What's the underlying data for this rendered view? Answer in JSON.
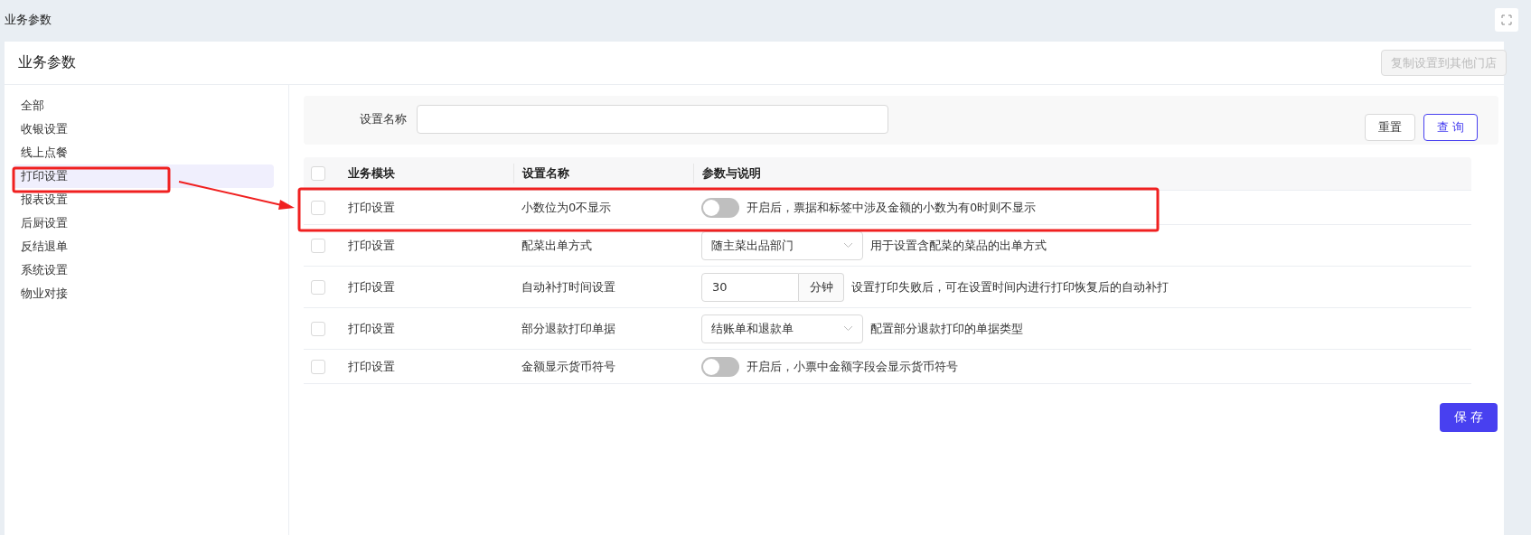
{
  "window": {
    "title": "业务参数"
  },
  "card": {
    "title": "业务参数",
    "copy_button": {
      "label": "复制设置到其他门店",
      "disabled": true
    }
  },
  "sidebar": {
    "items": [
      {
        "label": "全部",
        "selected": false
      },
      {
        "label": "收银设置",
        "selected": false
      },
      {
        "label": "线上点餐",
        "selected": false
      },
      {
        "label": "打印设置",
        "selected": true
      },
      {
        "label": "报表设置",
        "selected": false
      },
      {
        "label": "后厨设置",
        "selected": false
      },
      {
        "label": "反结退单",
        "selected": false
      },
      {
        "label": "系统设置",
        "selected": false
      },
      {
        "label": "物业对接",
        "selected": false
      }
    ]
  },
  "filter": {
    "label": "设置名称",
    "buttons": [
      {
        "label": "重置",
        "kind": "default"
      },
      {
        "label": "查 询",
        "kind": "primary"
      }
    ]
  },
  "table": {
    "header_checked": false,
    "columns": [
      "业务模块",
      "设置名称",
      "参数与说明"
    ],
    "rows": [
      {
        "checked": false,
        "module": "打印设置",
        "name": "小数位为0不显示",
        "control": {
          "kind": "switch",
          "on": false
        },
        "description": "开启后，票据和标签中涉及金额的小数为有0时则不显示"
      },
      {
        "checked": false,
        "module": "打印设置",
        "name": "配菜出单方式",
        "control": {
          "kind": "select",
          "value": "随主菜出品部门"
        },
        "description": "用于设置含配菜的菜品的出单方式"
      },
      {
        "checked": false,
        "module": "打印设置",
        "name": "自动补打时间设置",
        "control": {
          "kind": "number",
          "value": "30",
          "unit": "分钟"
        },
        "description": "设置打印失败后，可在设置时间内进行打印恢复后的自动补打"
      },
      {
        "checked": false,
        "module": "打印设置",
        "name": "部分退款打印单据",
        "control": {
          "kind": "select",
          "value": "结账单和退款单"
        },
        "description": "配置部分退款打印的单据类型"
      },
      {
        "checked": false,
        "module": "打印设置",
        "name": "金额显示货币符号",
        "control": {
          "kind": "switch",
          "on": false
        },
        "description": "开启后，小票中金额字段会显示货币符号"
      }
    ]
  },
  "save_button": {
    "label": "保 存"
  }
}
